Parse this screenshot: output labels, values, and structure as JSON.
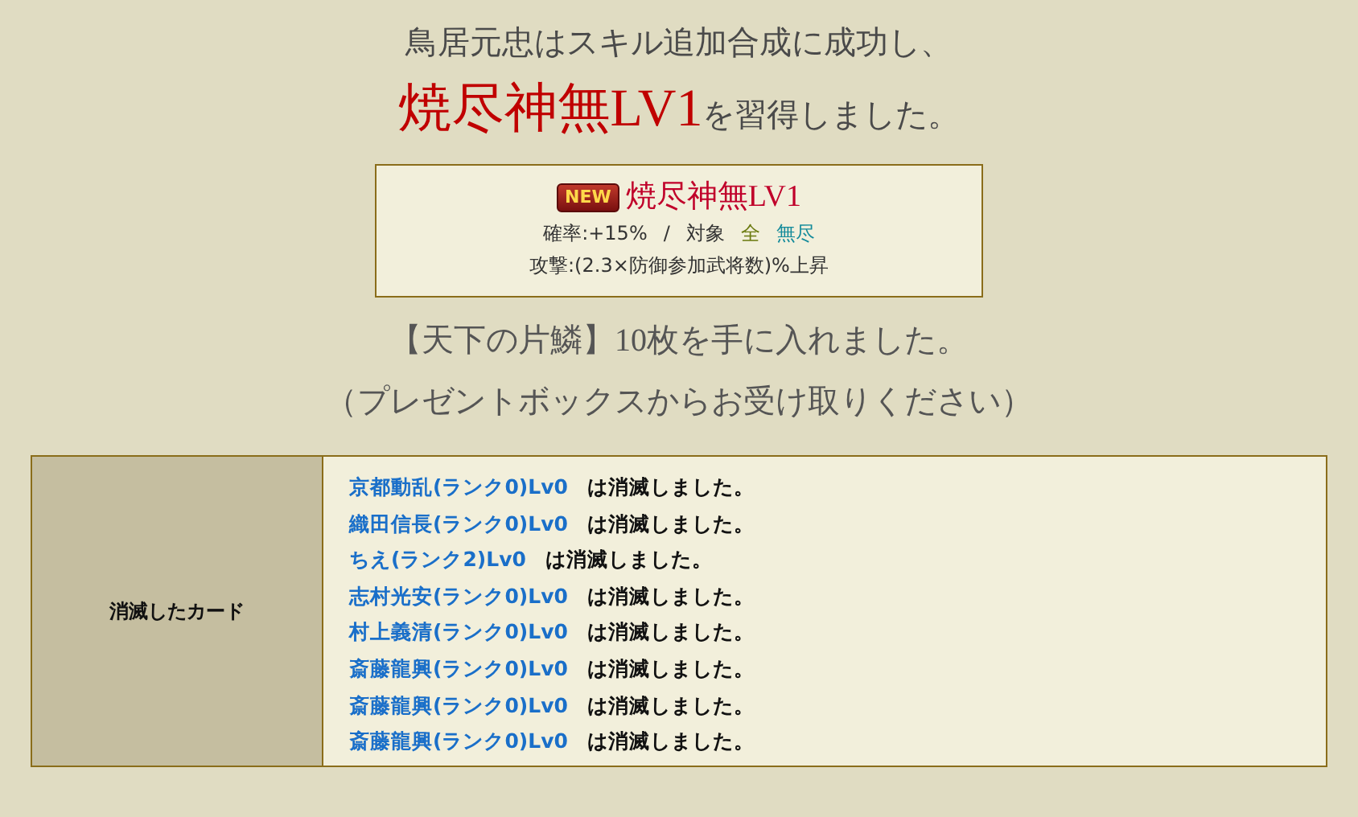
{
  "message": {
    "line1": "鳥居元忠はスキル追加合成に成功し、",
    "skill_name": "焼尽神無LV1",
    "line2_suffix": "を習得しました。"
  },
  "skill_card": {
    "badge": "NEW",
    "name": "焼尽神無LV1",
    "rate": "確率:+15%",
    "separator": "/",
    "target_label": "対象",
    "target_scope": "全",
    "target_type": "無尽",
    "effect": "攻撃:(2.3×防御参加武将数)%上昇"
  },
  "reward": {
    "line1": "【天下の片鱗】10枚を手に入れました。",
    "line2": "（プレゼントボックスからお受け取りください）"
  },
  "lost_cards": {
    "label": "消滅したカード",
    "rows": [
      {
        "card": "京都動乱(ランク0)Lv0",
        "message": "は消滅しました。"
      },
      {
        "card": "織田信長(ランク0)Lv0",
        "message": "は消滅しました。"
      },
      {
        "card": "ちえ(ランク2)Lv0",
        "message": "は消滅しました。"
      },
      {
        "card": "志村光安(ランク0)Lv0",
        "message": "は消滅しました。"
      },
      {
        "card": "村上義清(ランク0)Lv0",
        "message": "は消滅しました。"
      },
      {
        "card": "斎藤龍興(ランク0)Lv0",
        "message": "は消滅しました。"
      },
      {
        "card": "斎藤龍興(ランク0)Lv0",
        "message": "は消滅しました。"
      },
      {
        "card": "斎藤龍興(ランク0)Lv0",
        "message": "は消滅しました。"
      }
    ]
  }
}
